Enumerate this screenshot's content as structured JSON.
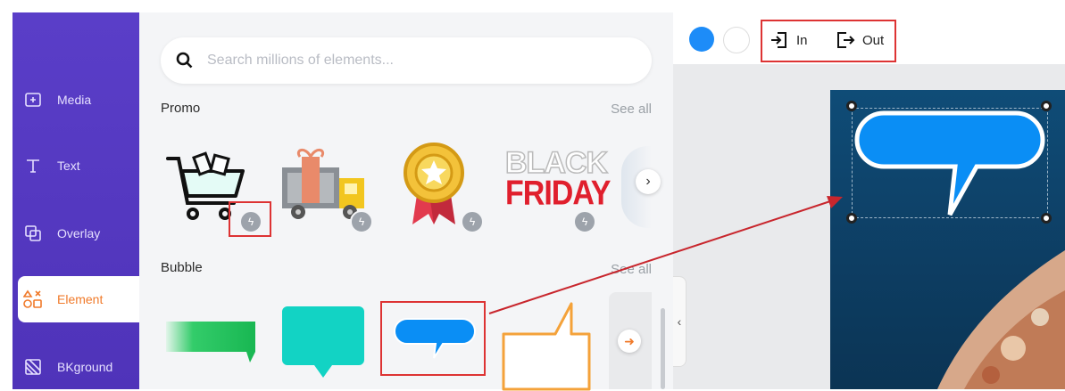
{
  "sidebar": {
    "items": [
      {
        "label": "Media",
        "icon": "folder-plus-icon"
      },
      {
        "label": "Text",
        "icon": "text-icon"
      },
      {
        "label": "Overlay",
        "icon": "overlay-icon"
      },
      {
        "label": "Element",
        "icon": "shapes-icon",
        "active": true
      },
      {
        "label": "BKground",
        "icon": "background-icon"
      }
    ]
  },
  "search": {
    "placeholder": "Search millions of elements..."
  },
  "sections": {
    "promo": {
      "title": "Promo",
      "see_all": "See all",
      "items": [
        "shopping-cart",
        "gift-truck",
        "star-medal",
        "black-friday"
      ]
    },
    "bubble": {
      "title": "Bubble",
      "see_all": "See all",
      "items": [
        "green-banner",
        "teal-speech",
        "blue-speech",
        "orange-callout"
      ]
    }
  },
  "black_friday": {
    "line1": "BLACK",
    "line2": "FRIDAY"
  },
  "toolbar": {
    "in_label": "In",
    "out_label": "Out"
  },
  "colors": {
    "sidebar": "#5238be",
    "accent": "#f07a2a",
    "blue": "#1d8cf8",
    "highlight": "#d33333"
  }
}
